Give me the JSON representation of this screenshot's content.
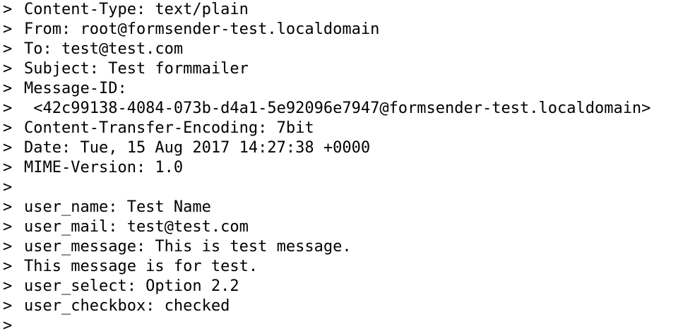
{
  "terminal": {
    "prompt_char": ">",
    "lines": [
      "Content-Type: text/plain",
      "From: root@formsender-test.localdomain",
      "To: test@test.com",
      "Subject: Test formmailer",
      "Message-ID:",
      " <42c99138-4084-073b-d4a1-5e92096e7947@formsender-test.localdomain>",
      "Content-Transfer-Encoding: 7bit",
      "Date: Tue, 15 Aug 2017 14:27:38 +0000",
      "MIME-Version: 1.0",
      "",
      "user_name: Test Name",
      "user_mail: test@test.com",
      "user_message: This is test message.",
      "This message is for test.",
      "user_select: Option 2.2",
      "user_checkbox: checked",
      ""
    ]
  },
  "colors": {
    "background": "#ffffff",
    "text": "#000000"
  }
}
